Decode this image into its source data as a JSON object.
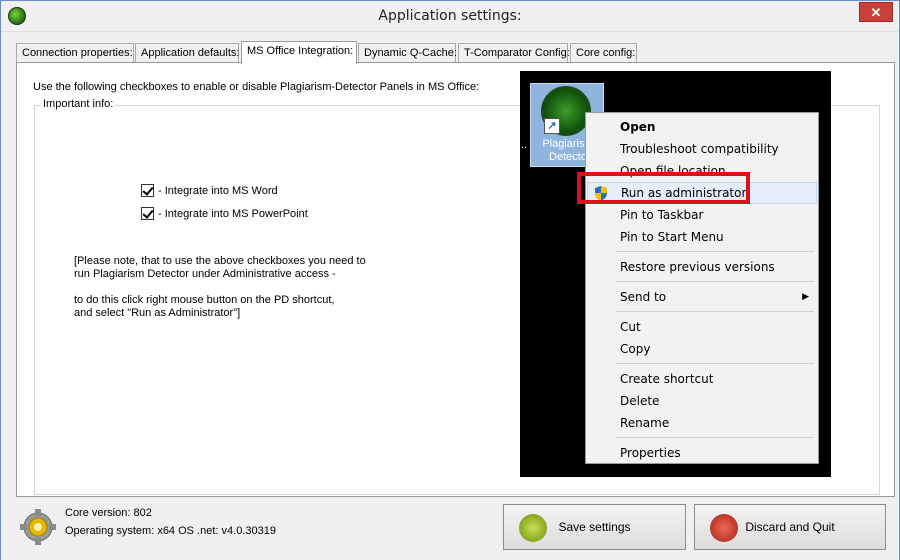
{
  "window": {
    "title": "Application settings:",
    "close_label": "✕"
  },
  "tabs": [
    {
      "label": "Connection properties:"
    },
    {
      "label": "Application defaults:"
    },
    {
      "label": "MS Office Integration:"
    },
    {
      "label": "Dynamic Q-Cache:"
    },
    {
      "label": "T-Comparator Config:"
    },
    {
      "label": "Core config:"
    }
  ],
  "active_tab": "MS Office Integration:",
  "panel": {
    "instruction": "Use the following checkboxes to enable or disable Plagiarism-Detector Panels in MS Office:",
    "group_label": "Important info:",
    "checkboxes": [
      {
        "label": "- Integrate into MS Word",
        "checked": true
      },
      {
        "label": "- Integrate into MS PowerPoint",
        "checked": true
      }
    ],
    "note_line1": "[Please note, that to use the above checkboxes you need to",
    "note_line2": "run Plagiarism Detector under Administrative access -",
    "note_line3": "to do this click right mouse button on the PD shortcut,",
    "note_line4": "and select \"Run as Administrator\"]"
  },
  "screenshot": {
    "shortcut_label_1": "Plagiarism",
    "shortcut_label_2": "Detecto",
    "shortcut_arrow": "↗",
    "dots": "..",
    "context_menu": [
      {
        "label": "Open"
      },
      {
        "label": "Troubleshoot compatibility"
      },
      {
        "label": "Open file location"
      },
      {
        "label": "Run as administrator"
      },
      {
        "label": "Pin to Taskbar"
      },
      {
        "label": "Pin to Start Menu"
      },
      {
        "label": "Restore previous versions"
      },
      {
        "label": "Send to"
      },
      {
        "label": "Cut"
      },
      {
        "label": "Copy"
      },
      {
        "label": "Create shortcut"
      },
      {
        "label": "Delete"
      },
      {
        "label": "Rename"
      },
      {
        "label": "Properties"
      }
    ],
    "submenu_arrow": "▶",
    "highlight_color": "#d8121b"
  },
  "status": {
    "core_version": "Core version: 802",
    "os": "Operating system: x64 OS .net: v4.0.30319"
  },
  "buttons": {
    "save": "Save settings",
    "discard": "Discard and Quit"
  }
}
